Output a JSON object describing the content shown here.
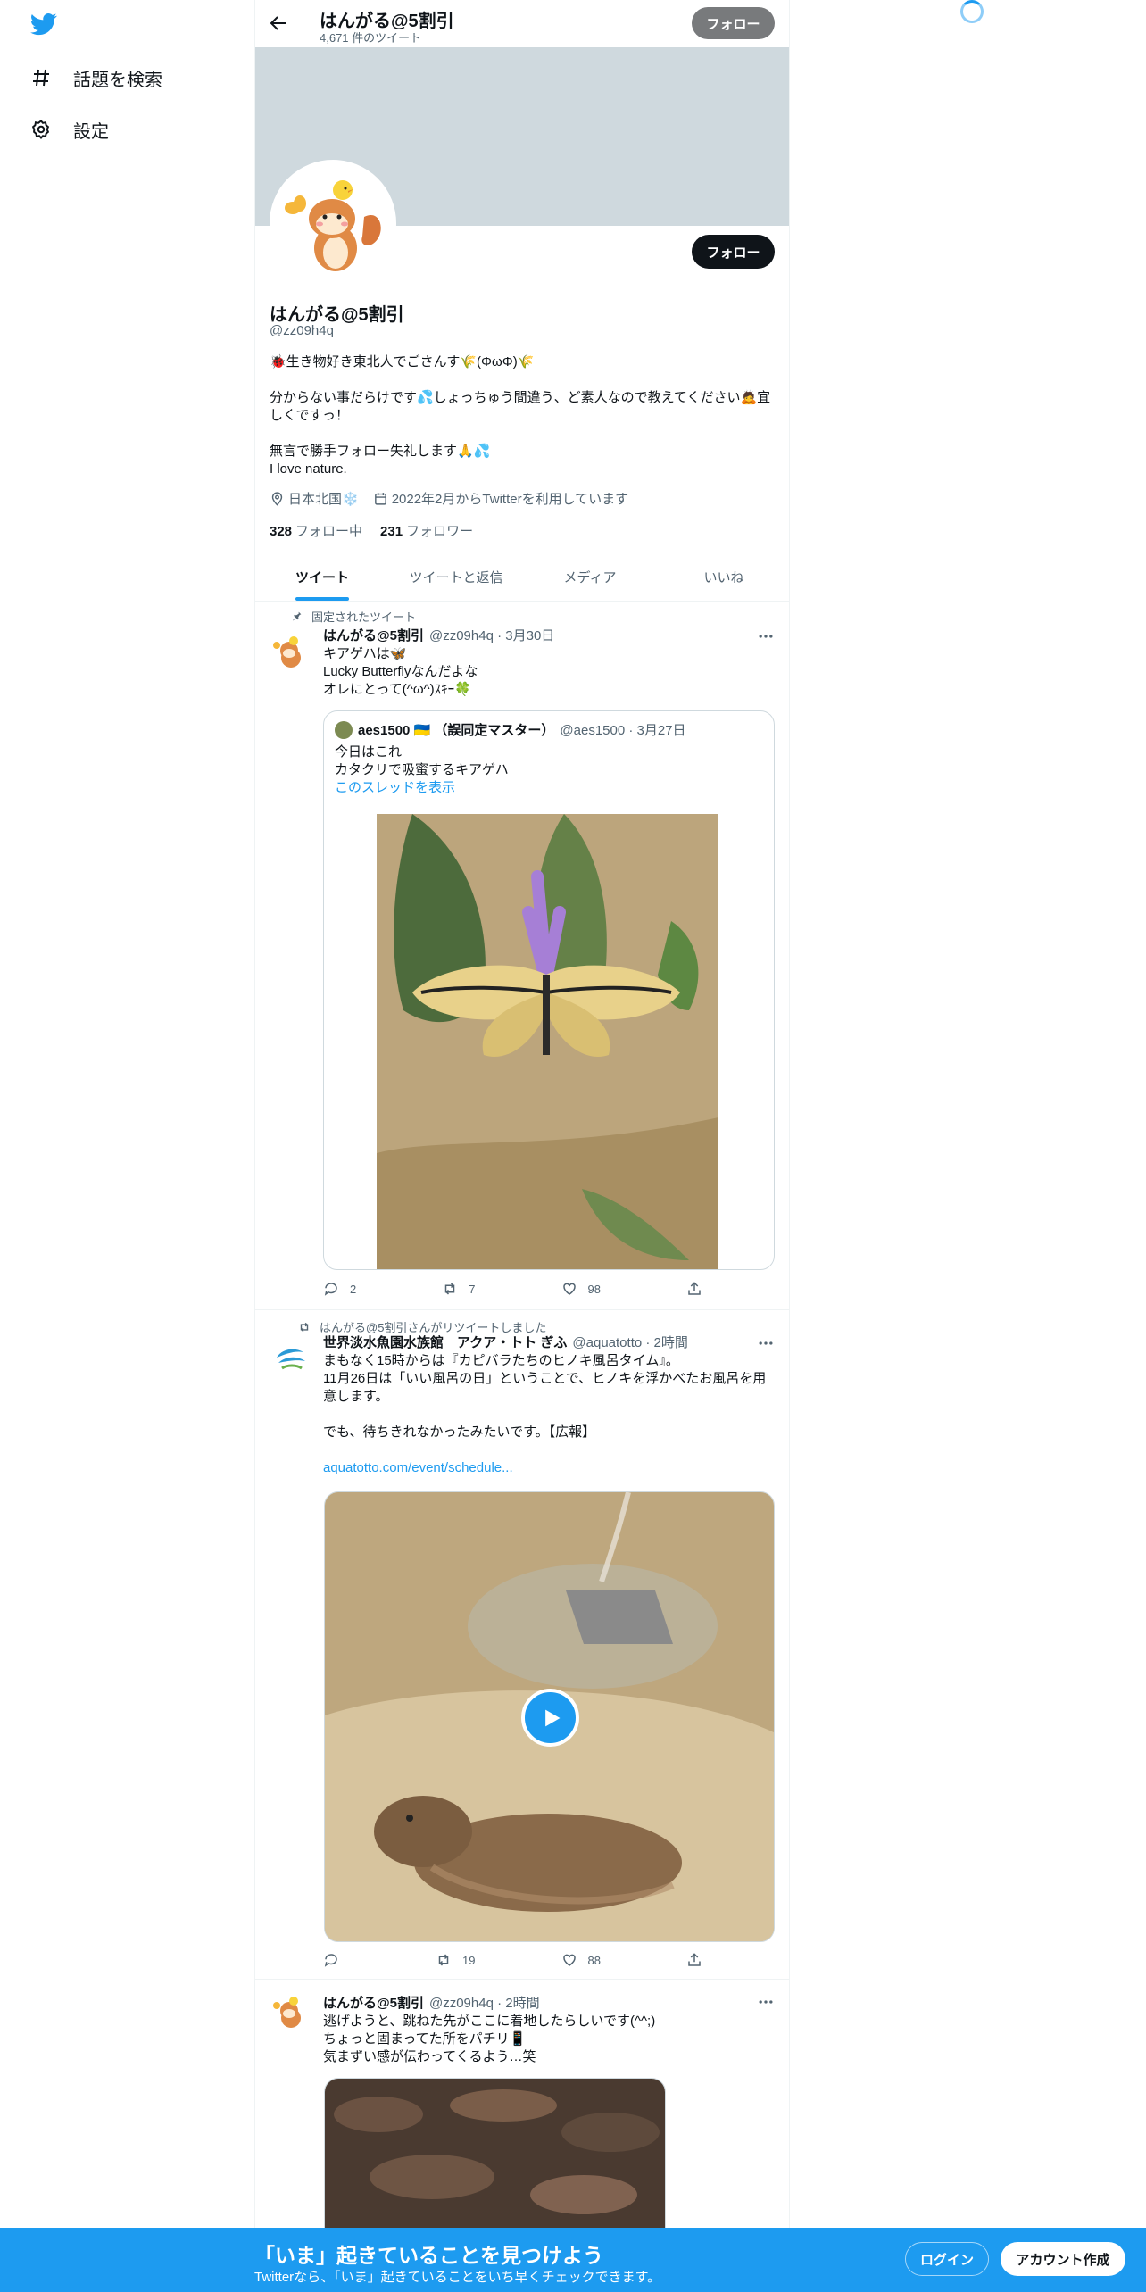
{
  "nav": {
    "explore_label": "話題を検索",
    "settings_label": "設定"
  },
  "header": {
    "name": "はんがる@5割引",
    "tweet_count": "4,671 件のツイート",
    "follow_label": "フォロー"
  },
  "profile": {
    "follow_label": "フォロー",
    "display_name": "はんがる@5割引",
    "handle": "@zz09h4q",
    "bio": [
      "🐞生き物好き東北人でごさんす🌾(ΦωΦ)🌾",
      "",
      "分からない事だらけです💦しょっちゅう間違う、ど素人なので教えてください🙇宜しくですっ！",
      "",
      "無言で勝手フォロー失礼します🙏💦",
      "I love nature."
    ],
    "location": "日本北国❄️",
    "joined": "2022年2月からTwitterを利用しています",
    "following_count": "328",
    "following_label": "フォロー中",
    "followers_count": "231",
    "followers_label": "フォロワー"
  },
  "tabs": [
    "ツイート",
    "ツイートと返信",
    "メディア",
    "いいね"
  ],
  "tweets": [
    {
      "social": "固定されたツイート",
      "name": "はんがる@5割引",
      "meta": "@zz09h4q · 3月30日",
      "text": [
        "キアゲハは🦋",
        "Lucky Butterflyなんだよな",
        "オレにとって(^ω^)ｽｷｰ🍀"
      ],
      "quote": {
        "name": "aes1500 🇺🇦 （誤同定マスター）",
        "meta": "@aes1500 · 3月27日",
        "text": [
          "今日はこれ",
          "カタクリで吸蜜するキアゲハ"
        ],
        "thread_link": "このスレッドを表示"
      },
      "replies": "2",
      "retweets": "7",
      "likes": "98"
    },
    {
      "social": "はんがる@5割引さんがリツイートしました",
      "name": "世界淡水魚園水族館　アクア・トト ぎふ",
      "meta": "@aquatotto · 2時間",
      "text": [
        "まもなく15時からは『カピバラたちのヒノキ風呂タイム』。",
        "11月26日は「いい風呂の日」ということで、ヒノキを浮かべたお風呂を用意します。",
        "",
        "でも、待ちきれなかったみたいです。【広報】",
        ""
      ],
      "link": "aquatotto.com/event/schedule...",
      "replies": "",
      "retweets": "19",
      "likes": "88"
    },
    {
      "name": "はんがる@5割引",
      "meta": "@zz09h4q · 2時間",
      "text": [
        "逃げようと、跳ねた先がここに着地したらしいです(^^;)",
        "ちょっと固まってた所をパチリ📱",
        "気まずい感が伝わってくるよう…笑"
      ]
    }
  ],
  "bottom_bar": {
    "title": "「いま」起きていることを見つけよう",
    "subtitle": "Twitterなら、「いま」起きていることをいち早くチェックできます。",
    "login_label": "ログイン",
    "signup_label": "アカウント作成"
  },
  "colors": {
    "accent": "#1d9bf0",
    "banner": "#cfd9de",
    "text": "#0f1419",
    "muted": "#536471"
  }
}
